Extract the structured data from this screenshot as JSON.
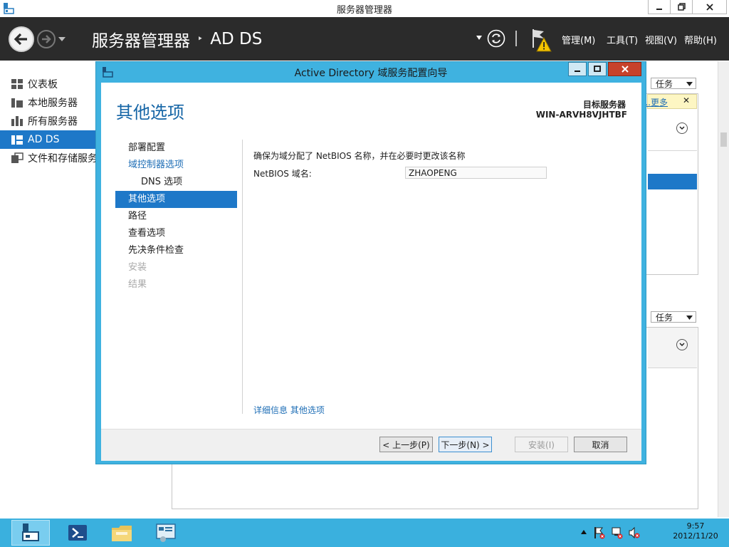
{
  "window": {
    "title": "服务器管理器"
  },
  "header": {
    "breadcrumb_app": "服务器管理器",
    "breadcrumb_sep": "‣",
    "breadcrumb_page": "AD DS",
    "menus": [
      "管理(M)",
      "工具(T)",
      "视图(V)",
      "帮助(H)"
    ]
  },
  "leftnav": {
    "items": [
      {
        "label": "仪表板",
        "icon": "dashboard-icon"
      },
      {
        "label": "本地服务器",
        "icon": "local-server-icon"
      },
      {
        "label": "所有服务器",
        "icon": "all-servers-icon"
      },
      {
        "label": "AD DS",
        "icon": "ad-ds-icon"
      },
      {
        "label": "文件和存储服务",
        "icon": "file-storage-icon"
      }
    ],
    "selected": "AD DS"
  },
  "background": {
    "task_label": "任务",
    "more_link": "更多...",
    "close_glyph": "✕"
  },
  "dialog": {
    "title": "Active Directory 域服务配置向导",
    "page_title": "其他选项",
    "target_label": "目标服务器",
    "target_value": "WIN-ARVH8VJHTBF",
    "steps": [
      {
        "label": "部署配置",
        "state": "normal"
      },
      {
        "label": "域控制器选项",
        "state": "link"
      },
      {
        "label": "DNS 选项",
        "state": "sub"
      },
      {
        "label": "其他选项",
        "state": "current"
      },
      {
        "label": "路径",
        "state": "normal"
      },
      {
        "label": "查看选项",
        "state": "normal"
      },
      {
        "label": "先决条件检查",
        "state": "normal"
      },
      {
        "label": "安装",
        "state": "disabled"
      },
      {
        "label": "结果",
        "state": "disabled"
      }
    ],
    "description": "确保为域分配了 NetBIOS 名称，并在必要时更改该名称",
    "netbios_label": "NetBIOS 域名:",
    "netbios_value": "ZHAOPENG",
    "more_info": "详细信息 其他选项",
    "buttons": {
      "prev": "< 上一步(P)",
      "next": "下一步(N) >",
      "install": "安装(I)",
      "cancel": "取消"
    }
  },
  "taskbar": {
    "apps": [
      "server-manager-icon",
      "powershell-icon",
      "file-explorer-icon",
      "control-panel-icon"
    ],
    "clock_time": "9:57",
    "clock_date": "2012/11/20"
  },
  "colors": {
    "accent": "#1e78c8",
    "dialog_frame": "#3fb2e0",
    "header_bg": "#2b2b2b",
    "taskbar": "#3ab0de"
  }
}
